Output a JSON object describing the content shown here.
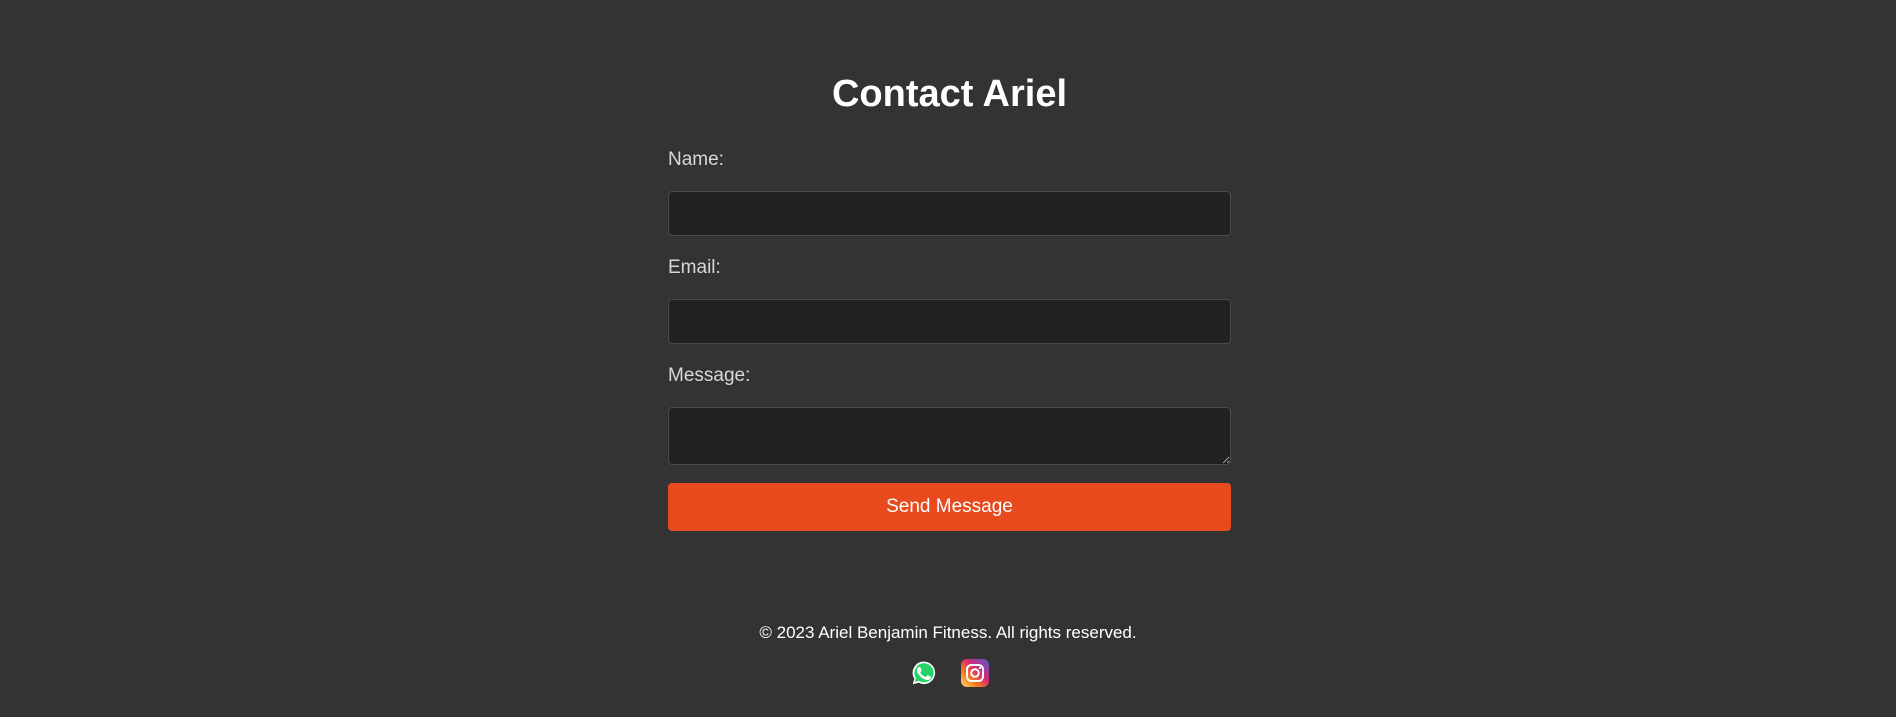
{
  "form": {
    "title": "Contact Ariel",
    "name_label": "Name:",
    "name_value": "",
    "email_label": "Email:",
    "email_value": "",
    "message_label": "Message:",
    "message_value": "",
    "submit_label": "Send Message"
  },
  "footer": {
    "copyright": "© 2023 Ariel Benjamin Fitness. All rights reserved.",
    "social": [
      {
        "icon": "whatsapp-icon"
      },
      {
        "icon": "instagram-icon"
      }
    ]
  },
  "colors": {
    "background": "#333333",
    "field_background": "#222222",
    "accent": "#e8491d",
    "whatsapp": "#25d366"
  }
}
